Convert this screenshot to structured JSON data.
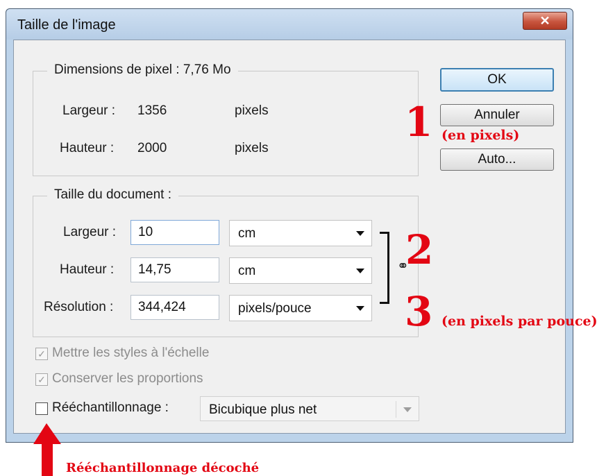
{
  "window": {
    "title": "Taille de l'image",
    "close_label": "✕"
  },
  "pixel_dimensions": {
    "legend": "Dimensions de pixel : 7,76 Mo",
    "width_label": "Largeur :",
    "width_value": "1356",
    "width_unit": "pixels",
    "height_label": "Hauteur :",
    "height_value": "2000",
    "height_unit": "pixels"
  },
  "document_size": {
    "legend": "Taille du document :",
    "width_label": "Largeur :",
    "width_value": "10",
    "width_unit": "cm",
    "height_label": "Hauteur :",
    "height_value": "14,75",
    "height_unit": "cm",
    "resolution_label": "Résolution :",
    "resolution_value": "344,424",
    "resolution_unit": "pixels/pouce",
    "link_icon": "chain-link-icon"
  },
  "buttons": {
    "ok": "OK",
    "cancel": "Annuler",
    "auto": "Auto..."
  },
  "options": {
    "scale_styles": {
      "label": "Mettre les styles à l'échelle",
      "checked": true,
      "enabled": false
    },
    "constrain": {
      "label": "Conserver les proportions",
      "checked": true,
      "enabled": false
    },
    "resample": {
      "label": "Rééchantillonnage :",
      "checked": false,
      "enabled": true
    },
    "resample_method": "Bicubique plus net"
  },
  "annotations": {
    "n1": "1",
    "n1_note": "(en pixels)",
    "n2": "2",
    "n3": "3",
    "n3_note": "(en pixels par pouce)",
    "resample_note": "Rééchantillonnage décoché",
    "color": "#e30613"
  }
}
